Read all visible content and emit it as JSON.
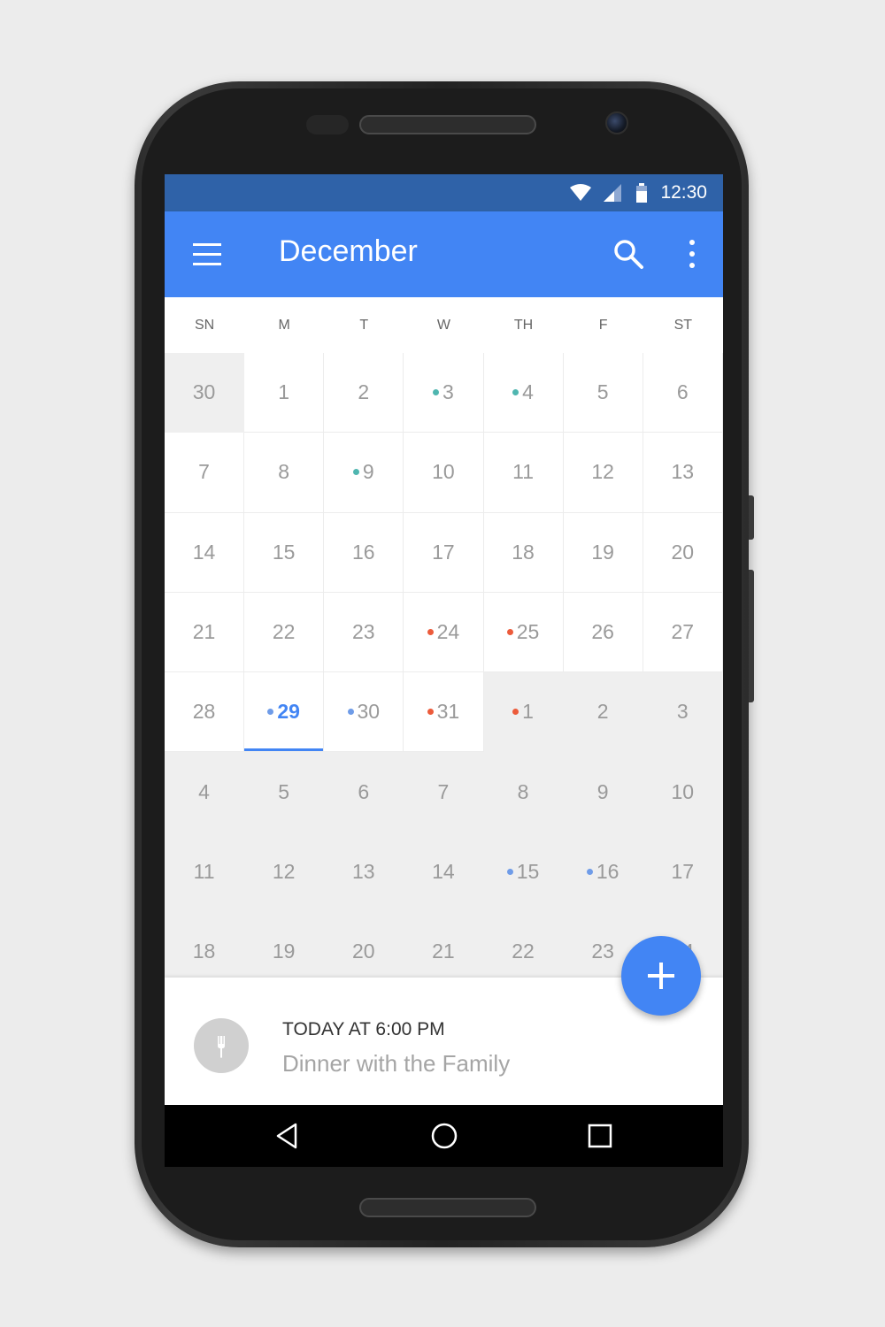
{
  "status_bar": {
    "time": "12:30"
  },
  "app_bar": {
    "title": "December"
  },
  "weekdays": [
    "SN",
    "M",
    "T",
    "W",
    "TH",
    "F",
    "ST"
  ],
  "calendar": {
    "weeks": [
      [
        {
          "day": "30",
          "out": true
        },
        {
          "day": "1"
        },
        {
          "day": "2"
        },
        {
          "day": "3",
          "dot": "teal"
        },
        {
          "day": "4",
          "dot": "teal"
        },
        {
          "day": "5"
        },
        {
          "day": "6"
        }
      ],
      [
        {
          "day": "7"
        },
        {
          "day": "8"
        },
        {
          "day": "9",
          "dot": "teal"
        },
        {
          "day": "10"
        },
        {
          "day": "11"
        },
        {
          "day": "12"
        },
        {
          "day": "13"
        }
      ],
      [
        {
          "day": "14"
        },
        {
          "day": "15"
        },
        {
          "day": "16"
        },
        {
          "day": "17"
        },
        {
          "day": "18"
        },
        {
          "day": "19"
        },
        {
          "day": "20"
        }
      ],
      [
        {
          "day": "21"
        },
        {
          "day": "22"
        },
        {
          "day": "23"
        },
        {
          "day": "24",
          "dot": "red"
        },
        {
          "day": "25",
          "dot": "red"
        },
        {
          "day": "26"
        },
        {
          "day": "27"
        }
      ],
      [
        {
          "day": "28"
        },
        {
          "day": "29",
          "dot": "blue",
          "today": true
        },
        {
          "day": "30",
          "dot": "blue"
        },
        {
          "day": "31",
          "dot": "red"
        },
        {
          "day": "1",
          "dot": "red",
          "out": true
        },
        {
          "day": "2",
          "out": true
        },
        {
          "day": "3",
          "out": true
        }
      ],
      [
        {
          "day": "4",
          "out": true
        },
        {
          "day": "5",
          "out": true
        },
        {
          "day": "6",
          "out": true
        },
        {
          "day": "7",
          "out": true
        },
        {
          "day": "8",
          "out": true
        },
        {
          "day": "9",
          "out": true
        },
        {
          "day": "10",
          "out": true
        }
      ],
      [
        {
          "day": "11",
          "out": true
        },
        {
          "day": "12",
          "out": true
        },
        {
          "day": "13",
          "out": true
        },
        {
          "day": "14",
          "out": true
        },
        {
          "day": "15",
          "dot": "blue",
          "out": true
        },
        {
          "day": "16",
          "dot": "blue",
          "out": true
        },
        {
          "day": "17",
          "out": true
        }
      ],
      [
        {
          "day": "18",
          "out": true
        },
        {
          "day": "19",
          "out": true
        },
        {
          "day": "20",
          "out": true
        },
        {
          "day": "21",
          "out": true
        },
        {
          "day": "22",
          "out": true
        },
        {
          "day": "23",
          "out": true
        },
        {
          "day": "24",
          "out": true
        }
      ]
    ]
  },
  "event": {
    "time": "TODAY AT 6:00 PM",
    "title": "Dinner with the Family",
    "icon": "fork-icon"
  },
  "colors": {
    "primary": "#4285f4",
    "status_bar": "#2f62a8",
    "dot_teal": "#4fb6b0",
    "dot_red": "#ec5b3b",
    "dot_blue": "#6f9ce8"
  }
}
